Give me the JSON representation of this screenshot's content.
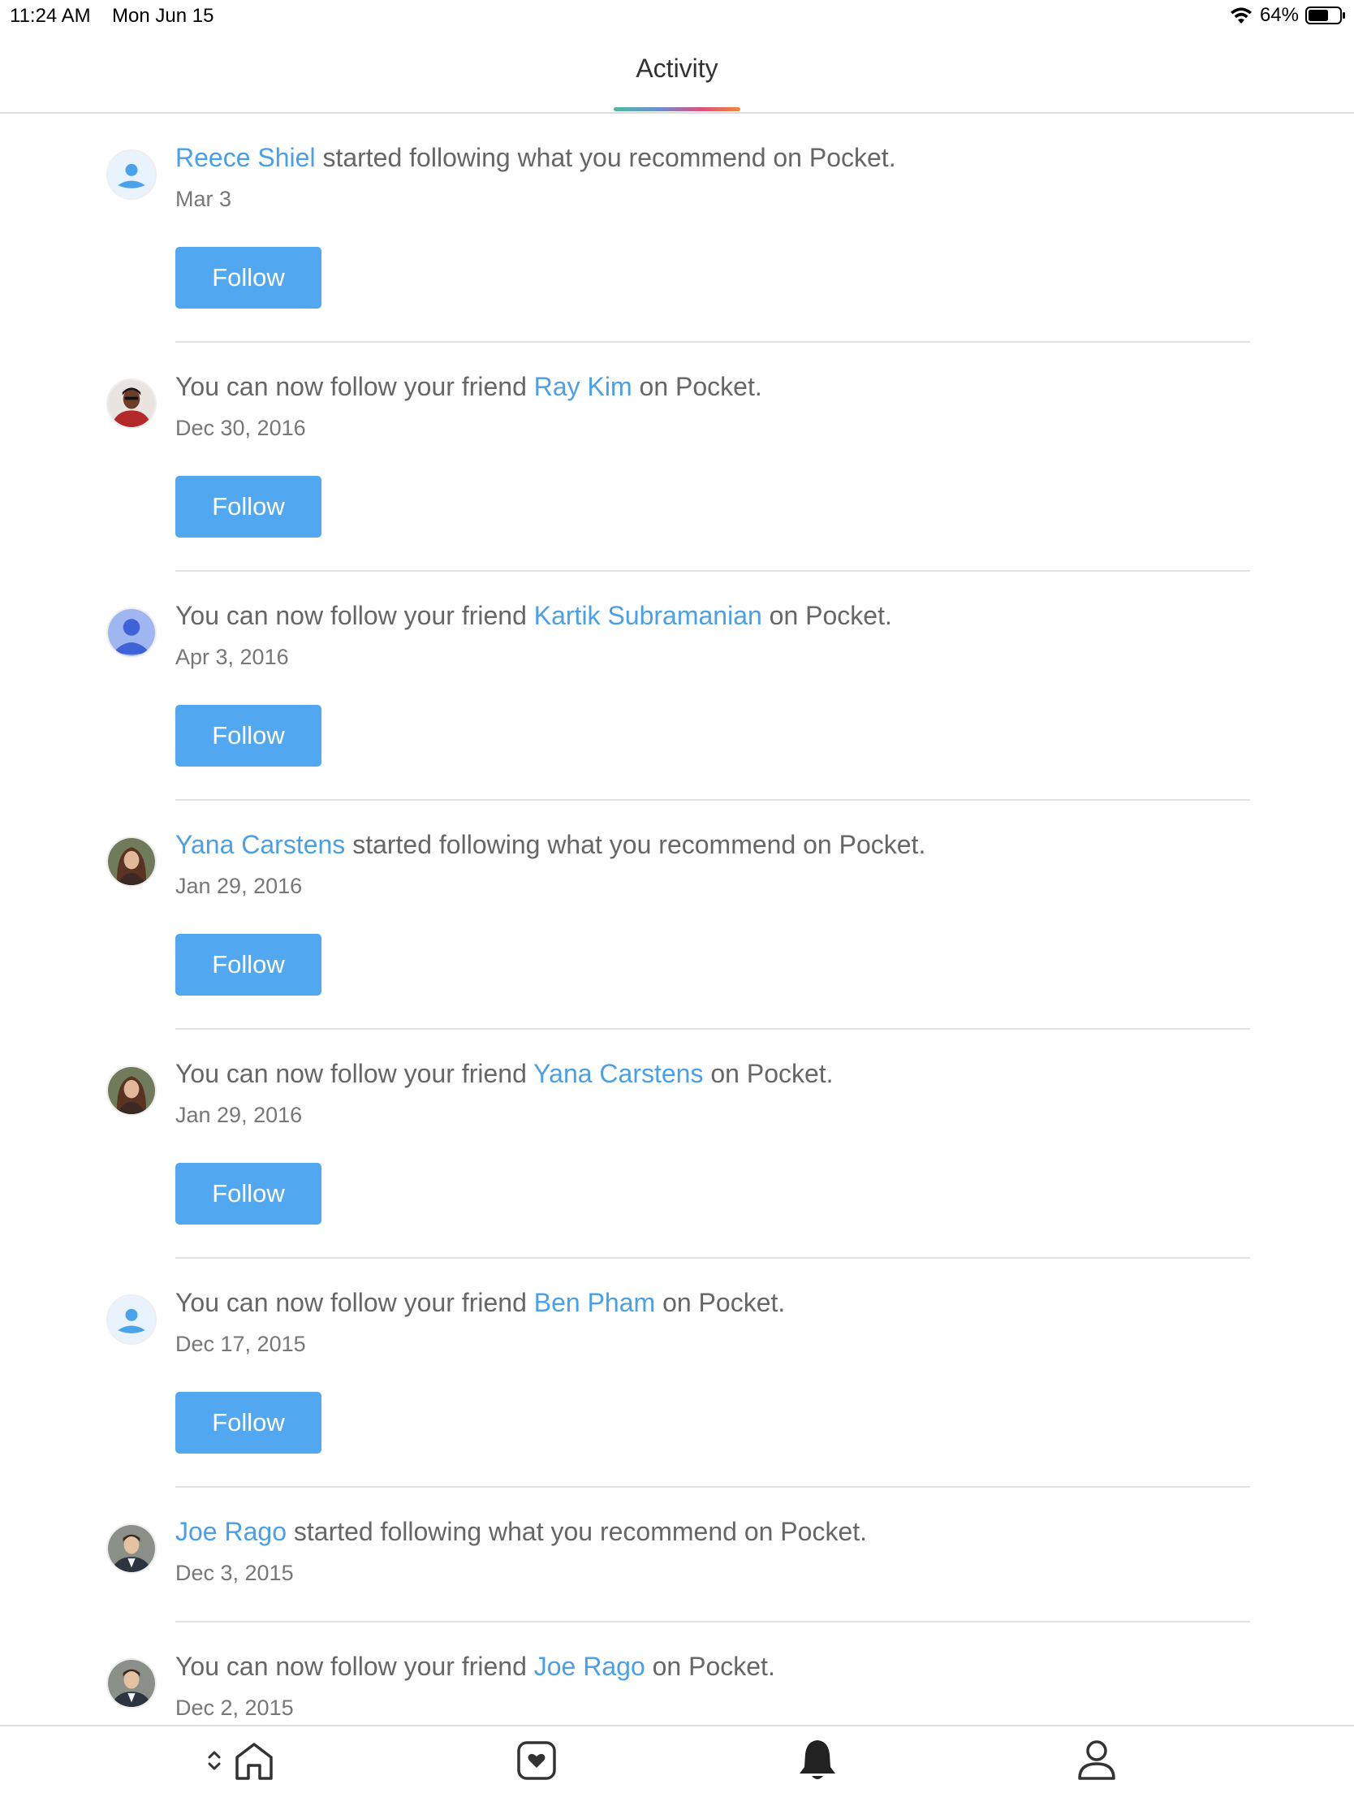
{
  "status_bar": {
    "time": "11:24 AM",
    "date": "Mon Jun 15",
    "battery": "64%",
    "battery_level": 0.64
  },
  "header": {
    "title": "Activity"
  },
  "colors": {
    "link_blue": "#4a9fe8",
    "button_blue": "#52a8f0",
    "body_text": "#666666"
  },
  "feed": {
    "items": [
      {
        "prefix": "",
        "name": "Reece Shiel",
        "suffix": " started following what you recommend on Pocket.",
        "date": "Mar 3",
        "button": "Follow",
        "avatar": "default-user-icon"
      },
      {
        "prefix": "You can now follow your friend ",
        "name": "Ray Kim",
        "suffix": " on Pocket.",
        "date": "Dec 30, 2016",
        "button": "Follow",
        "avatar": "photo"
      },
      {
        "prefix": "You can now follow your friend ",
        "name": "Kartik Subramanian",
        "suffix": " on Pocket.",
        "date": "Apr 3, 2016",
        "button": "Follow",
        "avatar": "default-user-icon"
      },
      {
        "prefix": "",
        "name": "Yana Carstens",
        "suffix": " started following what you recommend on Pocket.",
        "date": "Jan 29, 2016",
        "button": "Follow",
        "avatar": "photo"
      },
      {
        "prefix": "You can now follow your friend ",
        "name": "Yana Carstens",
        "suffix": " on Pocket.",
        "date": "Jan 29, 2016",
        "button": "Follow",
        "avatar": "photo"
      },
      {
        "prefix": "You can now follow your friend ",
        "name": "Ben Pham",
        "suffix": " on Pocket.",
        "date": "Dec 17, 2015",
        "button": "Follow",
        "avatar": "default-user-icon"
      },
      {
        "prefix": "",
        "name": "Joe Rago",
        "suffix": " started following what you recommend on Pocket.",
        "date": "Dec 3, 2015",
        "avatar": "photo"
      },
      {
        "prefix": "You can now follow your friend ",
        "name": "Joe Rago",
        "suffix": " on Pocket.",
        "date": "Dec 2, 2015",
        "avatar": "photo"
      }
    ]
  },
  "tab_bar": {
    "tabs": [
      {
        "icon": "home-icon"
      },
      {
        "icon": "pocket-icon"
      },
      {
        "icon": "bell-icon",
        "selected": true
      },
      {
        "icon": "profile-icon"
      }
    ]
  }
}
